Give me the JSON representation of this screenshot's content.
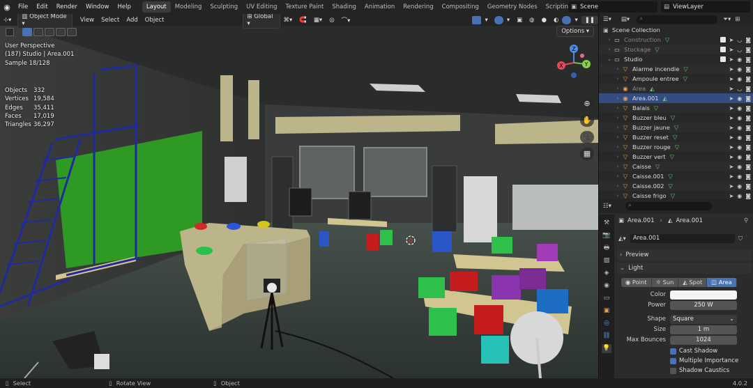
{
  "menu": {
    "items": [
      "File",
      "Edit",
      "Render",
      "Window",
      "Help"
    ]
  },
  "workspaces": {
    "tabs": [
      "Layout",
      "Modeling",
      "Sculpting",
      "UV Editing",
      "Texture Paint",
      "Shading",
      "Animation",
      "Rendering",
      "Compositing",
      "Geometry Nodes",
      "Scripting"
    ],
    "active": "Layout"
  },
  "scene": {
    "name": "Scene",
    "view_layer": "ViewLayer"
  },
  "viewport": {
    "mode": "Object Mode",
    "menus": [
      "View",
      "Select",
      "Add",
      "Object"
    ],
    "orientation": "Global",
    "options": "Options",
    "info": {
      "line1": "User Perspective",
      "line2": "(187) Studio | Area.001",
      "line3": "Sample 18/128"
    },
    "stats": [
      {
        "k": "Objects",
        "v": "332"
      },
      {
        "k": "Vertices",
        "v": "19,584"
      },
      {
        "k": "Edges",
        "v": "35,411"
      },
      {
        "k": "Faces",
        "v": "17,019"
      },
      {
        "k": "Triangles",
        "v": "36,297"
      }
    ],
    "gizmo": {
      "x": "X",
      "y": "Y",
      "z": "Z"
    }
  },
  "outliner": {
    "root": "Scene Collection",
    "rows": [
      {
        "name": "Construction",
        "type": "collection",
        "dim": true
      },
      {
        "name": "Stockage",
        "type": "collection",
        "dim": true
      },
      {
        "name": "Studio",
        "type": "collection",
        "dim": false
      },
      {
        "name": "Alarme incendie",
        "type": "object"
      },
      {
        "name": "Ampoule entree",
        "type": "object"
      },
      {
        "name": "Area",
        "type": "light",
        "dim": true
      },
      {
        "name": "Area.001",
        "type": "light",
        "selected": true
      },
      {
        "name": "Balais",
        "type": "object"
      },
      {
        "name": "Buzzer bleu",
        "type": "object"
      },
      {
        "name": "Buzzer jaune",
        "type": "object"
      },
      {
        "name": "Buzzer reset",
        "type": "object"
      },
      {
        "name": "Buzzer rouge",
        "type": "object"
      },
      {
        "name": "Buzzer vert",
        "type": "object"
      },
      {
        "name": "Caisse",
        "type": "object"
      },
      {
        "name": "Caisse.001",
        "type": "object"
      },
      {
        "name": "Caisse.002",
        "type": "object"
      },
      {
        "name": "Caisse frigo",
        "type": "object"
      }
    ]
  },
  "properties": {
    "breadcrumb": {
      "object": "Area.001",
      "data": "Area.001"
    },
    "datablock": "Area.001",
    "panels": {
      "preview": "Preview",
      "light": "Light"
    },
    "light_types": [
      "Point",
      "Sun",
      "Spot",
      "Area"
    ],
    "active_type": "Area",
    "fields": {
      "color_label": "Color",
      "power_label": "Power",
      "power": "250 W",
      "shape_label": "Shape",
      "shape": "Square",
      "size_label": "Size",
      "size": "1 m",
      "max_bounces_label": "Max Bounces",
      "max_bounces": "1024"
    },
    "checks": [
      {
        "label": "Cast Shadow",
        "on": true
      },
      {
        "label": "Multiple Importance",
        "on": true
      },
      {
        "label": "Shadow Caustics",
        "on": false
      }
    ]
  },
  "statusbar": {
    "select": "Select",
    "rotate": "Rotate View",
    "object": "Object",
    "version": "4.0.2"
  }
}
